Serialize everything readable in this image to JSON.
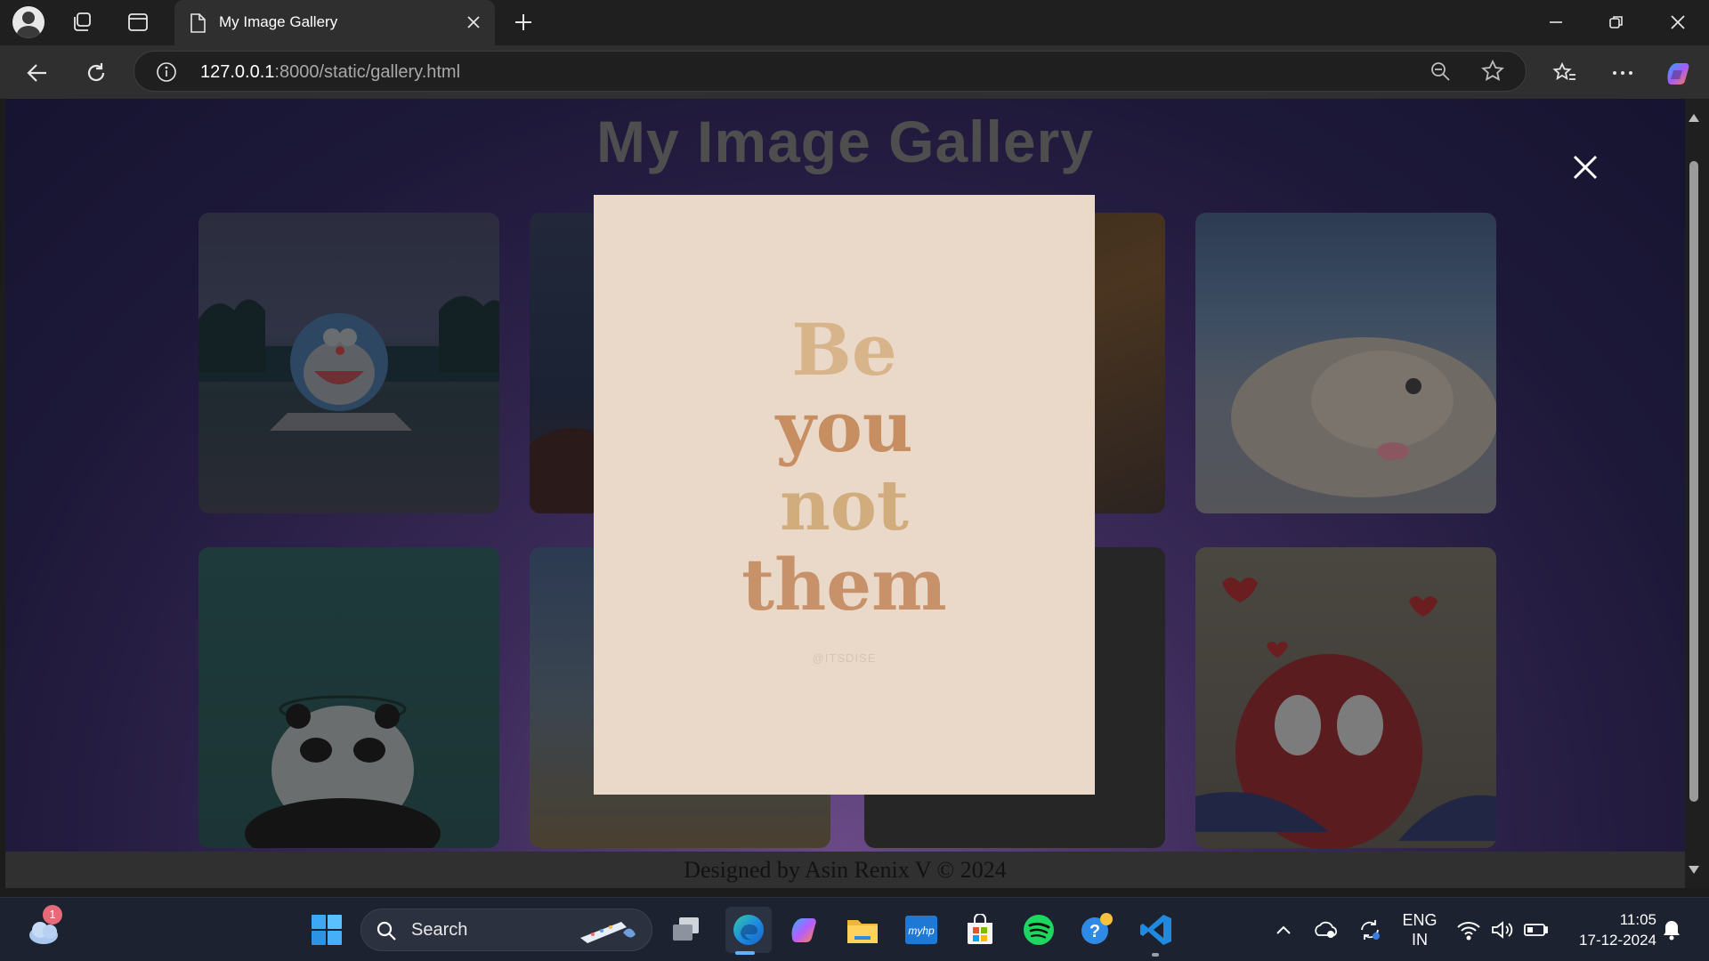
{
  "browser": {
    "tab_title": "My Image Gallery",
    "url_host": "127.0.0.1",
    "url_path": ":8000/static/gallery.html"
  },
  "page": {
    "title": "My Image Gallery",
    "footer": "Designed by Asin Renix V © 2024"
  },
  "gallery": {
    "cards": [
      {
        "subject": "doraemon"
      },
      {
        "subject": "silhouette-tree"
      },
      {
        "subject": "sunset-clouds"
      },
      {
        "subject": "white-puppy"
      },
      {
        "subject": "panda"
      },
      {
        "subject": "clouds-sky"
      },
      {
        "subject": "dark"
      },
      {
        "subject": "spiderman"
      }
    ]
  },
  "modal": {
    "quote_line1": "Be",
    "quote_line2": "you",
    "quote_line3": "not",
    "quote_line4": "them",
    "credit": "@ITSDISE"
  },
  "taskbar": {
    "search_label": "Search",
    "weather_badge": "1",
    "lang_line1": "ENG",
    "lang_line2": "IN",
    "time": "11:05",
    "date": "17-12-2024"
  },
  "colors": {
    "accent": "#5fb2ff",
    "modal_bg": "#ead9c9",
    "footer_bg": "#303030"
  }
}
